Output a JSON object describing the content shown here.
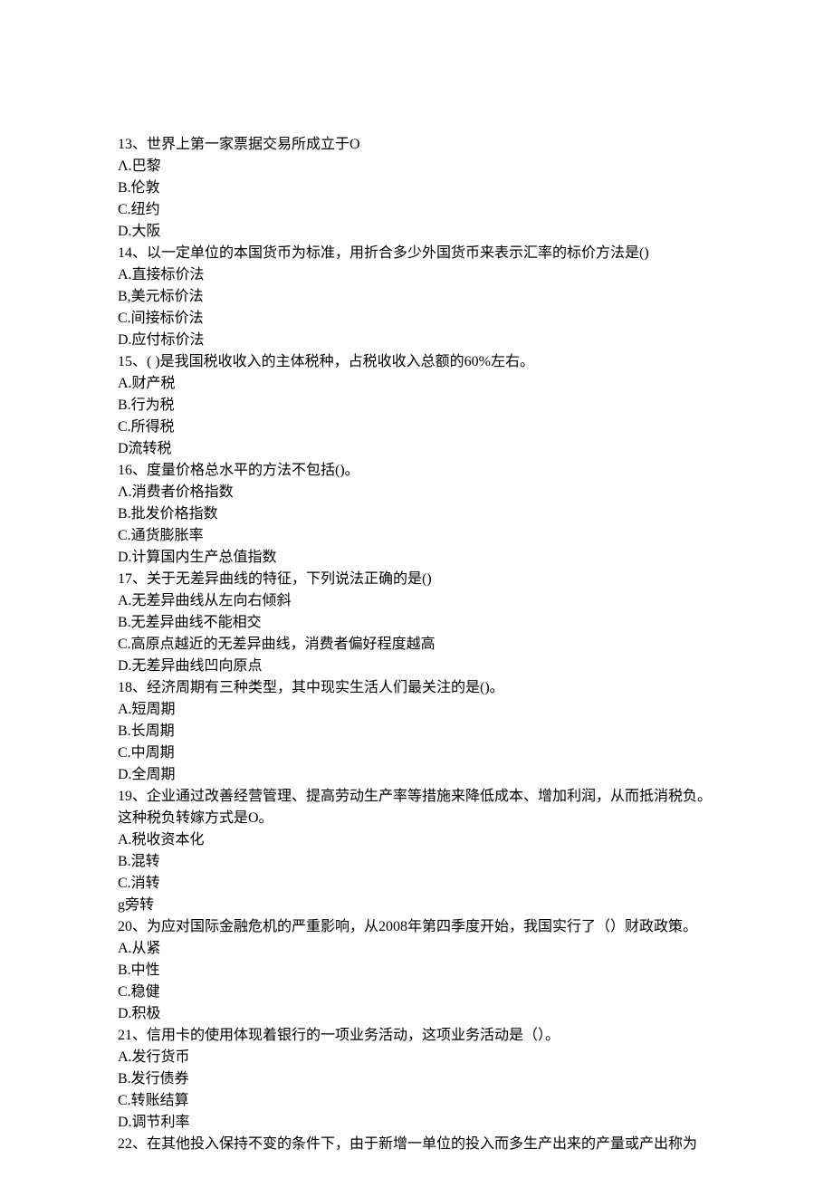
{
  "lines": [
    "13、世界上第一家票据交易所成立于O",
    "Λ.巴黎",
    "B.伦敦",
    "C.纽约",
    "D.大阪",
    "14、以一定单位的本国货币为标准，用折合多少外国货币来表示汇率的标价方法是()",
    "A.直接标价法",
    "B,美元标价法",
    "C.间接标价法",
    "D.应付标价法",
    "15、( )是我国税收收入的主体税种，占税收收入总额的60%左右。",
    "A.财产税",
    "B.行为税",
    "C.所得税",
    "D流转税",
    "16、度量价格总水平的方法不包括()。",
    "Λ.消费者价格指数",
    "B.批发价格指数",
    "C.通货膨胀率",
    "D.计算国内生产总值指数",
    "17、关于无差异曲线的特征，下列说法正确的是()",
    "A.无差异曲线从左向右倾斜",
    "B.无差异曲线不能相交",
    "C.高原点越近的无差异曲线，消费者偏好程度越高",
    "D.无差异曲线凹向原点",
    "18、经济周期有三种类型，其中现实生活人们最关注的是()。",
    "A.短周期",
    "B.长周期",
    "C.中周期",
    "D.全周期",
    "19、企业通过改善经营管理、提高劳动生产率等措施来降低成本、增加利润，从而抵消税负。这种税负转嫁方式是O。",
    "A.税收资本化",
    "B.混转",
    "C.消转",
    "g旁转",
    "20、为应对国际金融危机的严重影响，从2008年第四季度开始，我国实行了（）财政政策。",
    "A.从紧",
    "B.中性",
    "C.稳健",
    "D.积极",
    "21、信用卡的使用体现着银行的一项业务活动，这项业务活动是（）。",
    "A.发行货币",
    "B.发行债券",
    "C.转账结算",
    "D.调节利率",
    "22、在其他投入保持不变的条件下，由于新增一单位的投入而多生产出来的产量或产出称为"
  ]
}
